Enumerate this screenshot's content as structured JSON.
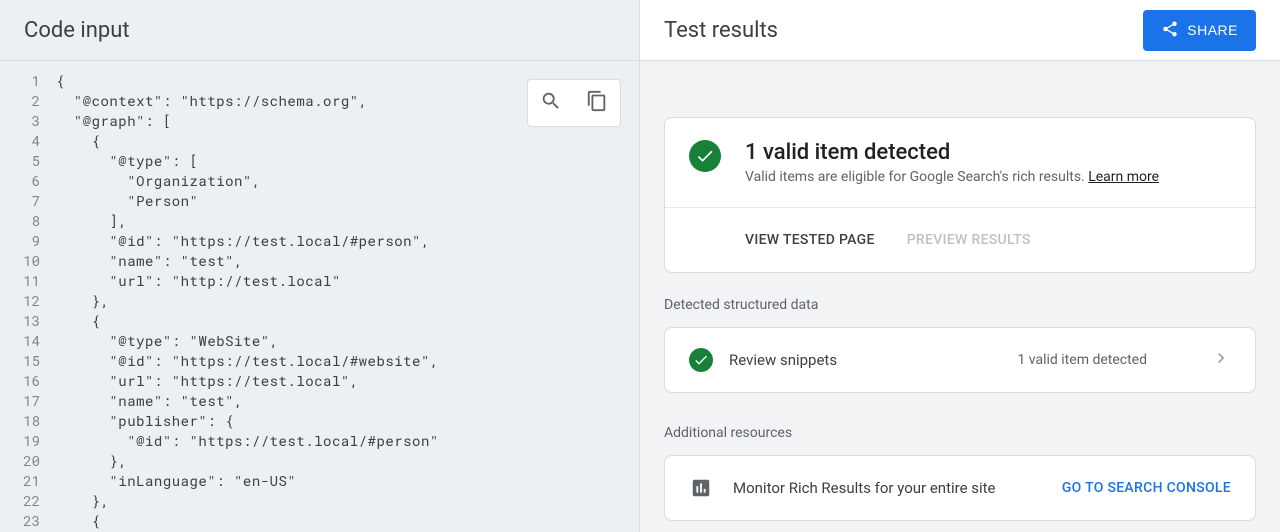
{
  "left": {
    "title": "Code input",
    "lines": [
      "{",
      "  \"@context\": \"https://schema.org\",",
      "  \"@graph\": [",
      "    {",
      "      \"@type\": [",
      "        \"Organization\",",
      "        \"Person\"",
      "      ],",
      "      \"@id\": \"https://test.local/#person\",",
      "      \"name\": \"test\",",
      "      \"url\": \"http://test.local\"",
      "    },",
      "    {",
      "      \"@type\": \"WebSite\",",
      "      \"@id\": \"https://test.local/#website\",",
      "      \"url\": \"https://test.local\",",
      "      \"name\": \"test\",",
      "      \"publisher\": {",
      "        \"@id\": \"https://test.local/#person\"",
      "      },",
      "      \"inLanguage\": \"en-US\"",
      "    },",
      "    {"
    ]
  },
  "right": {
    "title": "Test results",
    "share_label": "SHARE",
    "valid_title": "1 valid item detected",
    "valid_sub": "Valid items are eligible for Google Search's rich results. ",
    "learn_more": "Learn more",
    "view_tested": "VIEW TESTED PAGE",
    "preview_results": "PREVIEW RESULTS",
    "detected_label": "Detected structured data",
    "row_label": "Review snippets",
    "row_count": "1 valid item detected",
    "resources_label": "Additional resources",
    "resource_text": "Monitor Rich Results for your entire site",
    "resource_cta": "GO TO SEARCH CONSOLE"
  }
}
